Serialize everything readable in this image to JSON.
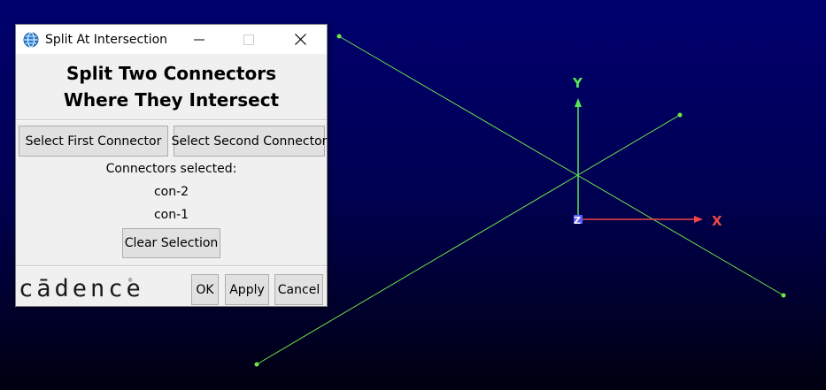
{
  "window": {
    "title": "Split At Intersection"
  },
  "dialog": {
    "heading_line1": "Split Two Connectors",
    "heading_line2": "Where They Intersect",
    "select_first_label": "Select First Connector",
    "select_second_label": "Select Second Connector",
    "selected_label": "Connectors selected:",
    "selected_items": [
      "con-2",
      "con-1"
    ],
    "clear_label": "Clear Selection",
    "ok_label": "OK",
    "apply_label": "Apply",
    "cancel_label": "Cancel",
    "logo_text": "cādence",
    "logo_mark": "®"
  },
  "viewport": {
    "axis_x_label": "X",
    "axis_y_label": "Y",
    "axis_z_label": "Z",
    "colors": {
      "background_top": "#00006e",
      "background_bottom": "#000010",
      "connector": "#6ee64a",
      "axis_x": "#f04646",
      "axis_y": "#55e655",
      "axis_z": "#5a5aff"
    },
    "connectors": [
      "con-1",
      "con-2"
    ]
  },
  "icons": {
    "app": "globe-icon",
    "minimize": "minimize-icon",
    "maximize": "maximize-icon",
    "close": "close-icon"
  }
}
